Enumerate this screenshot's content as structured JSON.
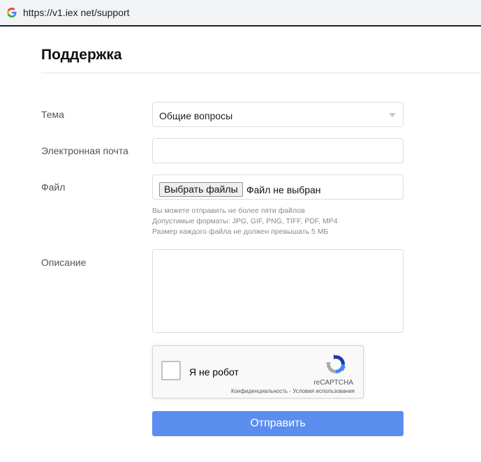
{
  "browser": {
    "url": "https://v1.iex net/support"
  },
  "page": {
    "title": "Поддержка"
  },
  "form": {
    "topic": {
      "label": "Тема",
      "value": "Общие вопросы"
    },
    "email": {
      "label": "Электронная почта",
      "value": ""
    },
    "file": {
      "label": "Файл",
      "button_label": "Выбрать файлы",
      "status": "Файл не выбран",
      "hints": [
        "Вы можете отправить не более пяти файлов",
        "Допустимые форматы: JPG, GIF, PNG, TIFF, PDF, MP4",
        "Размер каждого файла не должен превышать 5 МБ"
      ]
    },
    "description": {
      "label": "Описание",
      "value": ""
    },
    "recaptcha": {
      "label": "Я не робот",
      "brand": "reCAPTCHA",
      "links": "Конфиденциальность - Условия использования"
    },
    "submit_label": "Отправить"
  },
  "colors": {
    "accent": "#5b8def",
    "border": "#dcdcdc",
    "label_text": "#555555"
  },
  "icons": {
    "browser_site": "google-g-icon",
    "select_arrow": "triangle-down-icon",
    "recaptcha_logo": "recaptcha-logo-icon"
  }
}
